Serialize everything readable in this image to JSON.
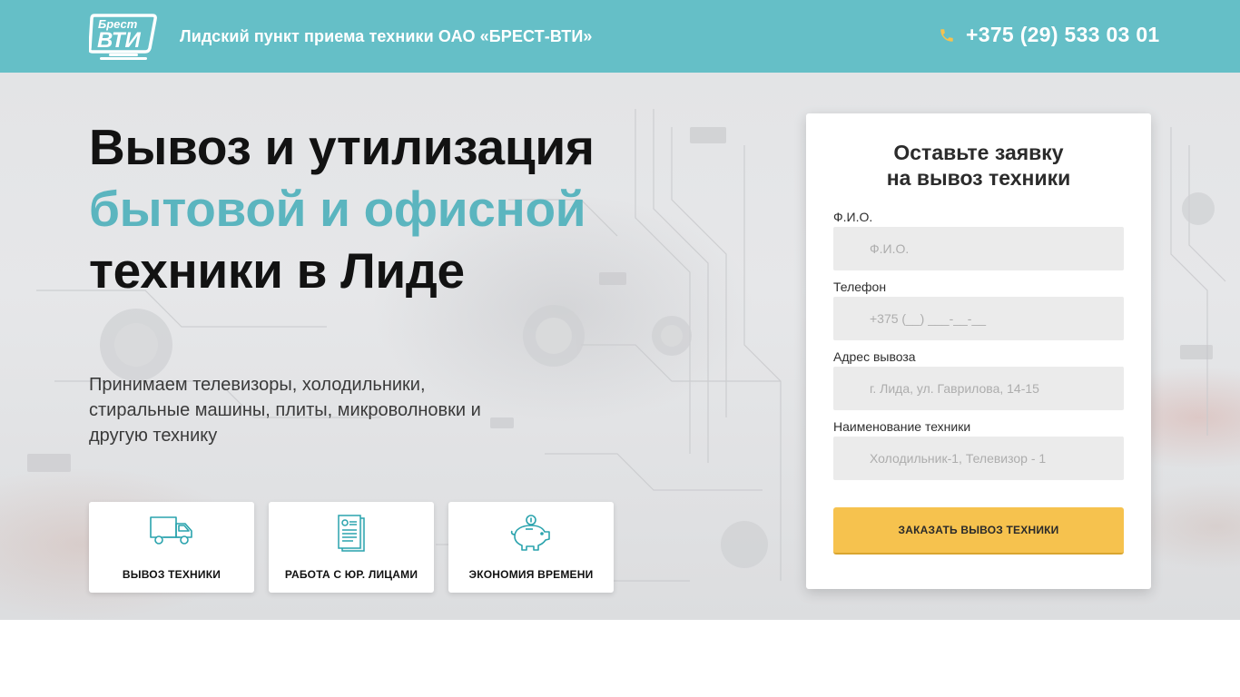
{
  "header": {
    "logo_text_top": "Брест",
    "logo_text_main": "ВТИ",
    "title": "Лидский пункт приема техники ОАО «БРЕСТ-ВТИ»",
    "phone": "+375 (29) 533 03 01"
  },
  "hero": {
    "title_line1": "Вывоз и утилизация",
    "title_line2": "бытовой и офисной",
    "title_line3": "техники в Лиде",
    "description": "Принимаем телевизоры, холодильники, стиральные машины, плиты, микроволновки и другую технику"
  },
  "features": [
    {
      "label": "ВЫВОЗ ТЕХНИКИ",
      "icon": "truck-icon"
    },
    {
      "label": "РАБОТА С ЮР. ЛИЦАМИ",
      "icon": "document-icon"
    },
    {
      "label": "ЭКОНОМИЯ ВРЕМЕНИ",
      "icon": "piggy-bank-icon"
    }
  ],
  "form": {
    "title_line1": "Оставьте заявку",
    "title_line2": "на вывоз техники",
    "fields": [
      {
        "label": "Ф.И.О.",
        "placeholder": "Ф.И.О.",
        "value": ""
      },
      {
        "label": "Телефон",
        "placeholder": "+375 (__) ___-__-__",
        "value": ""
      },
      {
        "label": "Адрес вывоза",
        "placeholder": "г. Лида, ул. Гаврилова, 14-15",
        "value": ""
      },
      {
        "label": "Наименование техники",
        "placeholder": "Холодильник-1, Телевизор - 1",
        "value": ""
      }
    ],
    "submit_label": "ЗАКАЗАТЬ ВЫВОЗ ТЕХНИКИ"
  },
  "colors": {
    "header_bg": "#65bfc7",
    "accent_text": "#5bb5bf",
    "button_bg": "#f6c24e",
    "icon_teal": "#2aa3ad",
    "phone_icon": "#f6c24e"
  }
}
